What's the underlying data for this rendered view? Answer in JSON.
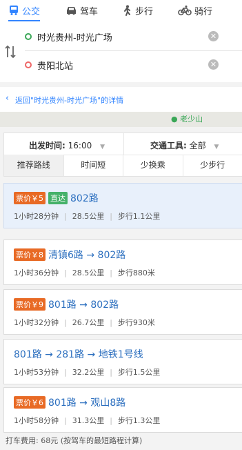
{
  "tabs": [
    {
      "label": "公交",
      "icon": "bus-icon",
      "active": true
    },
    {
      "label": "驾车",
      "icon": "car-icon",
      "active": false
    },
    {
      "label": "步行",
      "icon": "walk-icon",
      "active": false
    },
    {
      "label": "骑行",
      "icon": "bike-icon",
      "active": false
    }
  ],
  "route": {
    "origin": "时光贵州-时光广场",
    "destination": "贵阳北站"
  },
  "back_link": "返回\"时光贵州-时光广场\"的详情",
  "map_poi": "老少山",
  "filters": {
    "depart_label": "出发时间:",
    "depart_value": "16:00",
    "transport_label": "交通工具:",
    "transport_value": "全部"
  },
  "sort_options": [
    "推荐路线",
    "时间短",
    "少换乘",
    "少步行"
  ],
  "plans": [
    {
      "price": "票价￥5",
      "direct": "直达",
      "route": "802路",
      "time": "1小时28分钟",
      "distance": "28.5公里",
      "walk": "步行1.1公里",
      "active": true
    },
    {
      "price": "票价￥8",
      "route": "清镇6路 → 802路",
      "time": "1小时36分钟",
      "distance": "28.5公里",
      "walk": "步行880米"
    },
    {
      "price": "票价￥9",
      "route": "801路 → 802路",
      "time": "1小时32分钟",
      "distance": "26.7公里",
      "walk": "步行930米"
    },
    {
      "route": "801路 → 281路 → 地铁1号线",
      "time": "1小时53分钟",
      "distance": "32.2公里",
      "walk": "步行1.5公里"
    },
    {
      "price": "票价￥6",
      "route": "801路 → 观山8路",
      "time": "1小时58分钟",
      "distance": "31.3公里",
      "walk": "步行1.3公里"
    }
  ],
  "taxi_fare": "打车费用: 68元 (按驾车的最短路程计算)",
  "colors": {
    "accent": "#3385ff",
    "price_badge": "#e86a25",
    "direct_badge": "#45b16a"
  }
}
